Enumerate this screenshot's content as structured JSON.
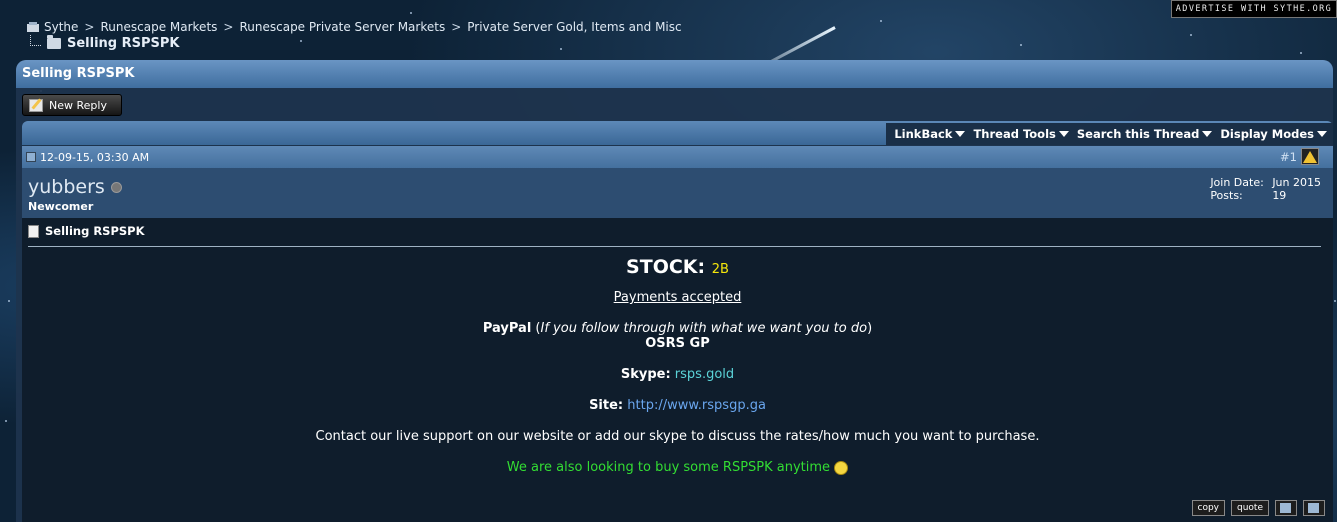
{
  "ad": {
    "text": "ADVERTISE WITH SYTHE.ORG"
  },
  "breadcrumb": {
    "items": [
      "Sythe",
      "Runescape Markets",
      "Runescape Private Server Markets",
      "Private Server Gold, Items and Misc"
    ],
    "separator": ">",
    "current": "Selling RSPSPK"
  },
  "thread": {
    "title": "Selling RSPSPK",
    "new_reply_label": "New Reply",
    "tools": [
      "LinkBack",
      "Thread Tools",
      "Search this Thread",
      "Display Modes"
    ]
  },
  "post": {
    "date": "12-09-15, 03:30 AM",
    "number": "#1",
    "user": {
      "name": "yubbers",
      "title": "Newcomer",
      "join_label": "Join Date:",
      "join_value": "Jun 2015",
      "posts_label": "Posts:",
      "posts_value": "19"
    },
    "title": "Selling RSPSPK",
    "stock_label": "STOCK:",
    "stock_value": "2B",
    "payments_heading": "Payments accepted",
    "paypal_label": "PayPal",
    "paypal_note": "If you follow through with what we want you to do",
    "osrs": "OSRS GP",
    "skype_label": "Skype:",
    "skype_value": "rsps.gold",
    "site_label": "Site:",
    "site_value": "http://www.rspsgp.ga",
    "contact_text": "Contact our live support on our website or add our skype to discuss the rates/how much you want to purchase.",
    "buy_text": "We are also looking to buy some RSPSPK anytime",
    "buttons": {
      "copy": "copy",
      "quote": "quote"
    }
  }
}
